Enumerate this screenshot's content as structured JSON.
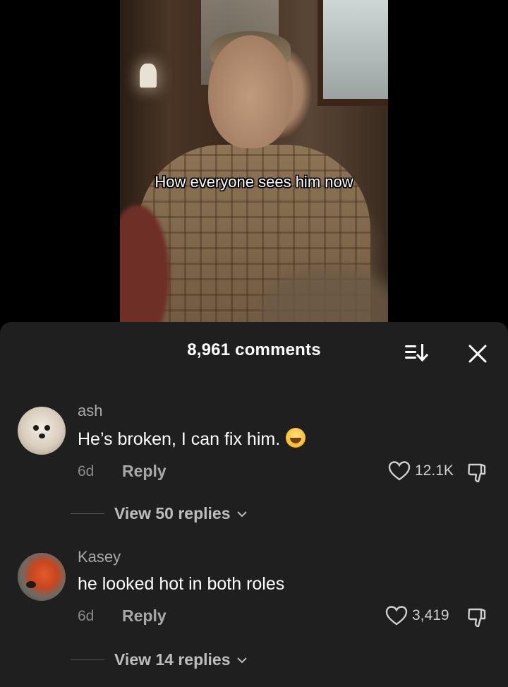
{
  "video": {
    "caption": "How everyone sees him now"
  },
  "comments_panel": {
    "title": "8,961 comments",
    "sort_icon": "sort-icon",
    "close_icon": "close-icon",
    "comments": [
      {
        "username": "ash",
        "text": "He’s broken, I can fix him.",
        "emoji": "joy-emoji",
        "time": "6d",
        "reply_label": "Reply",
        "likes": "12.1K",
        "view_replies": "View 50 replies"
      },
      {
        "username": "Kasey",
        "text": "he looked hot in both roles",
        "time": "6d",
        "reply_label": "Reply",
        "likes": "3,419",
        "view_replies": "View 14 replies"
      }
    ]
  },
  "colors": {
    "sheet_bg": "#1f1f1f",
    "text_primary": "#ffffff",
    "text_secondary": "#a9a9a9"
  }
}
